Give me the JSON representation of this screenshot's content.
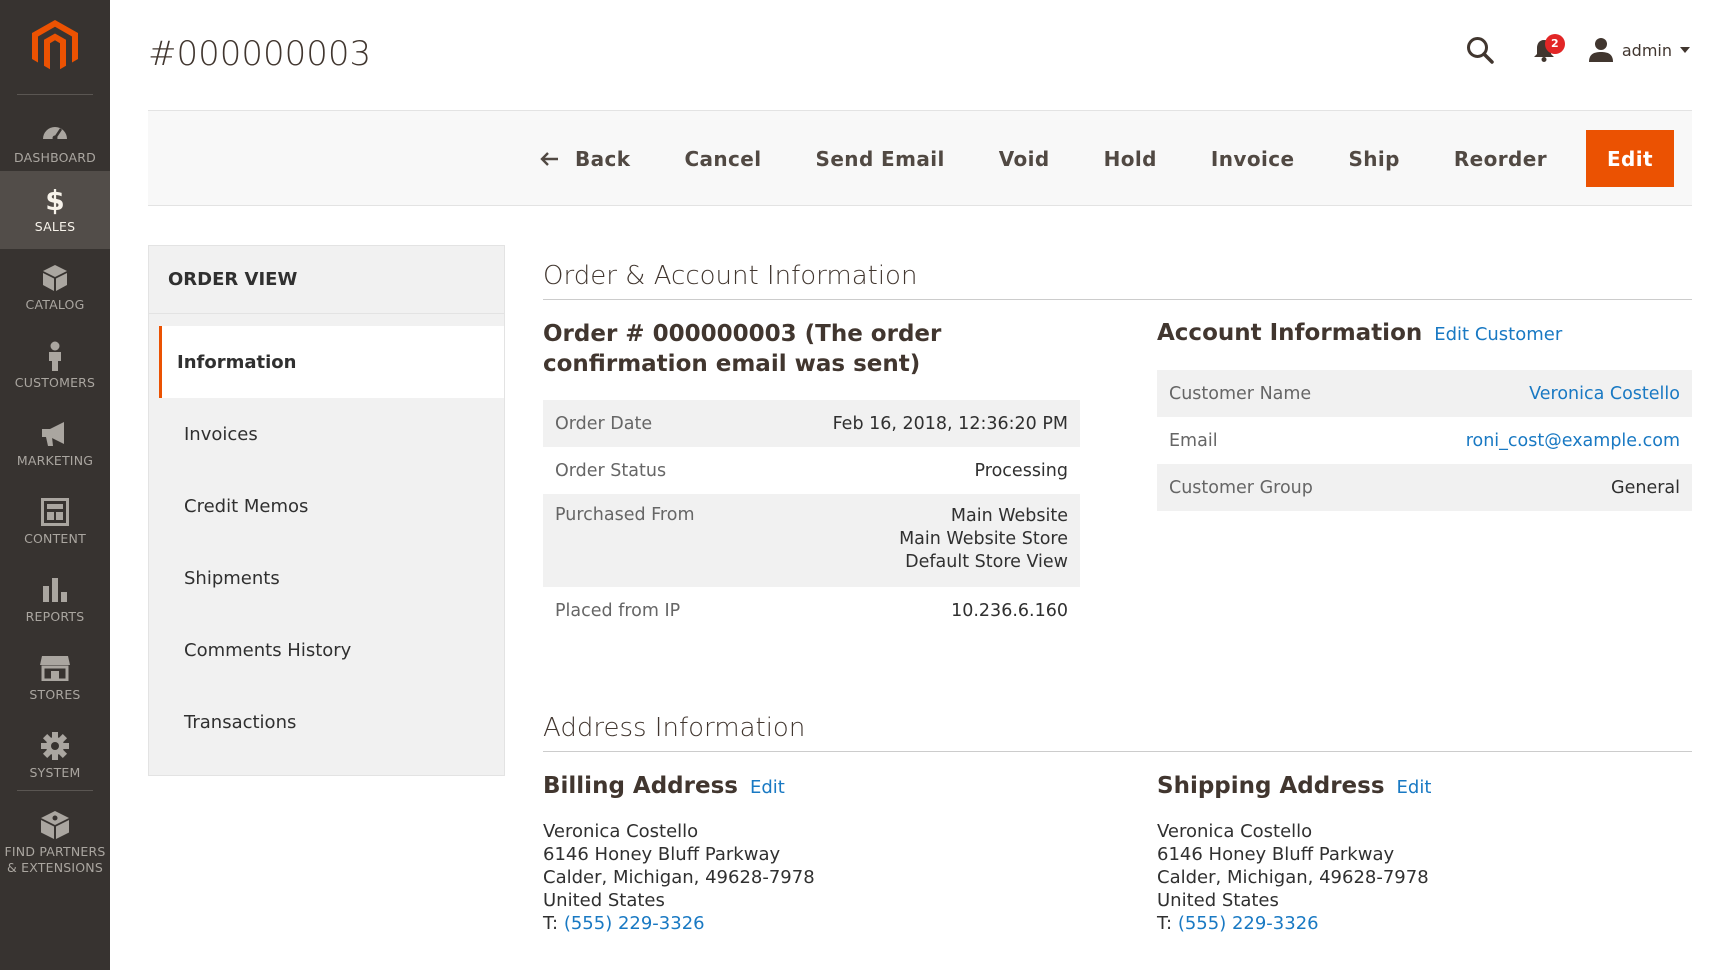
{
  "sidebar": {
    "logo": "magento-logo",
    "items": [
      {
        "label": "DASHBOARD",
        "icon": "dashboard-icon"
      },
      {
        "label": "SALES",
        "icon": "dollar-icon",
        "active": true
      },
      {
        "label": "CATALOG",
        "icon": "cube-icon"
      },
      {
        "label": "CUSTOMERS",
        "icon": "person-icon"
      },
      {
        "label": "MARKETING",
        "icon": "megaphone-icon"
      },
      {
        "label": "CONTENT",
        "icon": "layout-icon"
      },
      {
        "label": "REPORTS",
        "icon": "bar-chart-icon"
      },
      {
        "label": "STORES",
        "icon": "storefront-icon"
      },
      {
        "label": "SYSTEM",
        "icon": "gear-icon"
      },
      {
        "label": "FIND PARTNERS\n& EXTENSIONS",
        "icon": "extensions-icon"
      }
    ]
  },
  "header": {
    "title": "#000000003",
    "notification_count": "2",
    "user": "admin"
  },
  "actions": {
    "back": "Back",
    "cancel": "Cancel",
    "send_email": "Send Email",
    "void": "Void",
    "hold": "Hold",
    "invoice": "Invoice",
    "ship": "Ship",
    "reorder": "Reorder",
    "edit": "Edit"
  },
  "tabs": {
    "title": "ORDER VIEW",
    "items": [
      "Information",
      "Invoices",
      "Credit Memos",
      "Shipments",
      "Comments History",
      "Transactions"
    ]
  },
  "order_account": {
    "section_title": "Order & Account Information",
    "order_heading": "Order # 000000003 (The order confirmation email was sent)",
    "order_rows": {
      "order_date": {
        "label": "Order Date",
        "value": "Feb 16, 2018, 12:36:20 PM"
      },
      "order_status": {
        "label": "Order Status",
        "value": "Processing"
      },
      "purchased_from": {
        "label": "Purchased From",
        "lines": [
          "Main Website",
          "Main Website Store",
          "Default Store View"
        ]
      },
      "placed_ip": {
        "label": "Placed from IP",
        "value": "10.236.6.160"
      }
    },
    "account_heading": "Account Information",
    "edit_customer": "Edit Customer",
    "account_rows": {
      "name": {
        "label": "Customer Name",
        "value": "Veronica Costello"
      },
      "email": {
        "label": "Email",
        "value": "roni_cost@example.com"
      },
      "group": {
        "label": "Customer Group",
        "value": "General"
      }
    }
  },
  "address": {
    "section_title": "Address Information",
    "billing": {
      "heading": "Billing Address",
      "edit": "Edit",
      "name": "Veronica Costello",
      "street": "6146 Honey Bluff Parkway",
      "city_line": "Calder, Michigan, 49628-7978",
      "country": "United States",
      "phone_prefix": "T:",
      "phone": "(555) 229-3326"
    },
    "shipping": {
      "heading": "Shipping Address",
      "edit": "Edit",
      "name": "Veronica Costello",
      "street": "6146 Honey Bluff Parkway",
      "city_line": "Calder, Michigan, 49628-7978",
      "country": "United States",
      "phone_prefix": "T:",
      "phone": "(555) 229-3326"
    }
  },
  "colors": {
    "accent": "#eb5202",
    "sidebar_bg": "#373330",
    "link": "#1979c3",
    "badge": "#e22626"
  }
}
